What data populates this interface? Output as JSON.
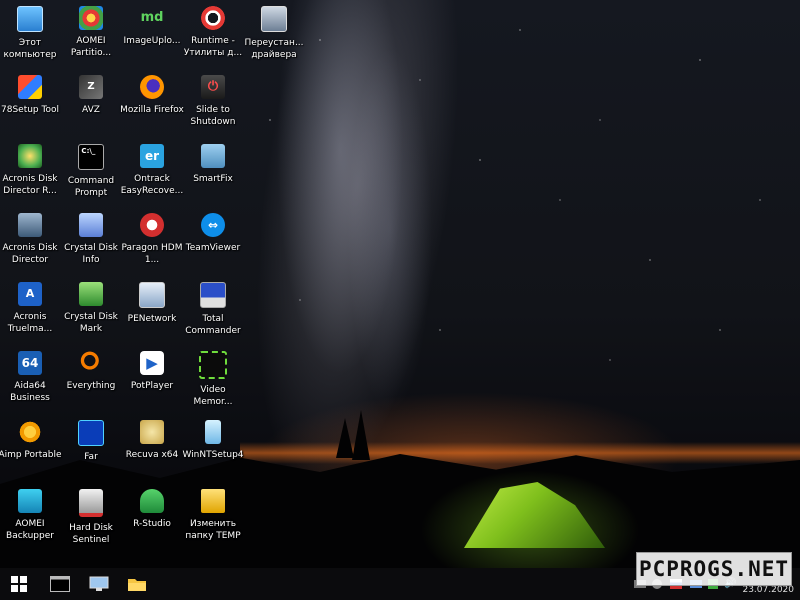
{
  "desktop": {
    "icons": [
      {
        "label": "Этот компьютер",
        "icon": "computer-icon"
      },
      {
        "label": "AOMEI Partitio...",
        "icon": "aomei-partition-icon"
      },
      {
        "label": "ImageUplo...",
        "icon": "imageuploader-icon"
      },
      {
        "label": "Runtime - Утилиты д...",
        "icon": "lifebuoy-icon"
      },
      {
        "label": "Переустан... драйвера",
        "icon": "driver-reinstall-icon"
      },
      {
        "label": "78Setup Tool",
        "icon": "setup-tool-icon"
      },
      {
        "label": "AVZ",
        "icon": "avz-icon"
      },
      {
        "label": "Mozilla Firefox",
        "icon": "firefox-icon"
      },
      {
        "label": "Slide to Shutdown",
        "icon": "shutdown-icon"
      },
      {
        "label": "Acronis Disk Director R...",
        "icon": "acronis-disk-director-r-icon"
      },
      {
        "label": "Command Prompt",
        "icon": "command-prompt-icon"
      },
      {
        "label": "Ontrack EasyRecove...",
        "icon": "ontrack-icon"
      },
      {
        "label": "SmartFix",
        "icon": "smartfix-icon"
      },
      {
        "label": "Acronis Disk Director",
        "icon": "acronis-disk-director-icon"
      },
      {
        "label": "Crystal Disk Info",
        "icon": "crystal-disk-info-icon"
      },
      {
        "label": "Paragon HDM 1...",
        "icon": "paragon-icon"
      },
      {
        "label": "TeamViewer",
        "icon": "teamviewer-icon"
      },
      {
        "label": "Acronis Truelma...",
        "icon": "acronis-trueimage-icon"
      },
      {
        "label": "Crystal Disk Mark",
        "icon": "crystal-disk-mark-icon"
      },
      {
        "label": "PENetwork",
        "icon": "penetwork-icon"
      },
      {
        "label": "Total Commander",
        "icon": "total-commander-icon"
      },
      {
        "label": "Aida64 Business",
        "icon": "aida64-icon"
      },
      {
        "label": "Everything",
        "icon": "everything-search-icon"
      },
      {
        "label": "PotPlayer",
        "icon": "potplayer-icon"
      },
      {
        "label": "Video Memor...",
        "icon": "video-memory-icon"
      },
      {
        "label": "Aimp Portable",
        "icon": "aimp-icon"
      },
      {
        "label": "Far",
        "icon": "far-manager-icon"
      },
      {
        "label": "Recuva x64",
        "icon": "recuva-icon"
      },
      {
        "label": "WinNTSetup4",
        "icon": "winntsetup-icon"
      },
      {
        "label": "AOMEI Backupper",
        "icon": "aomei-backupper-icon"
      },
      {
        "label": "Hard Disk Sentinel",
        "icon": "hard-disk-sentinel-icon"
      },
      {
        "label": "R-Studio",
        "icon": "r-studio-icon"
      },
      {
        "label": "Изменить папку TEMP",
        "icon": "change-temp-folder-icon"
      }
    ]
  },
  "taskbar": {
    "items": [
      {
        "name": "start-button",
        "icon": "windows-logo-icon"
      },
      {
        "name": "taskbar-command-prompt",
        "icon": "command-prompt-icon"
      },
      {
        "name": "taskbar-network",
        "icon": "network-icon"
      },
      {
        "name": "taskbar-explorer",
        "icon": "folder-icon"
      }
    ],
    "clock_date": "23.07.2020"
  },
  "watermark": {
    "text": "PCPROGS.NET"
  },
  "colors": {
    "taskbar_bg": "#0b0b0d",
    "icon_label": "#ffffff",
    "tent_green": "#9fdc2a"
  }
}
